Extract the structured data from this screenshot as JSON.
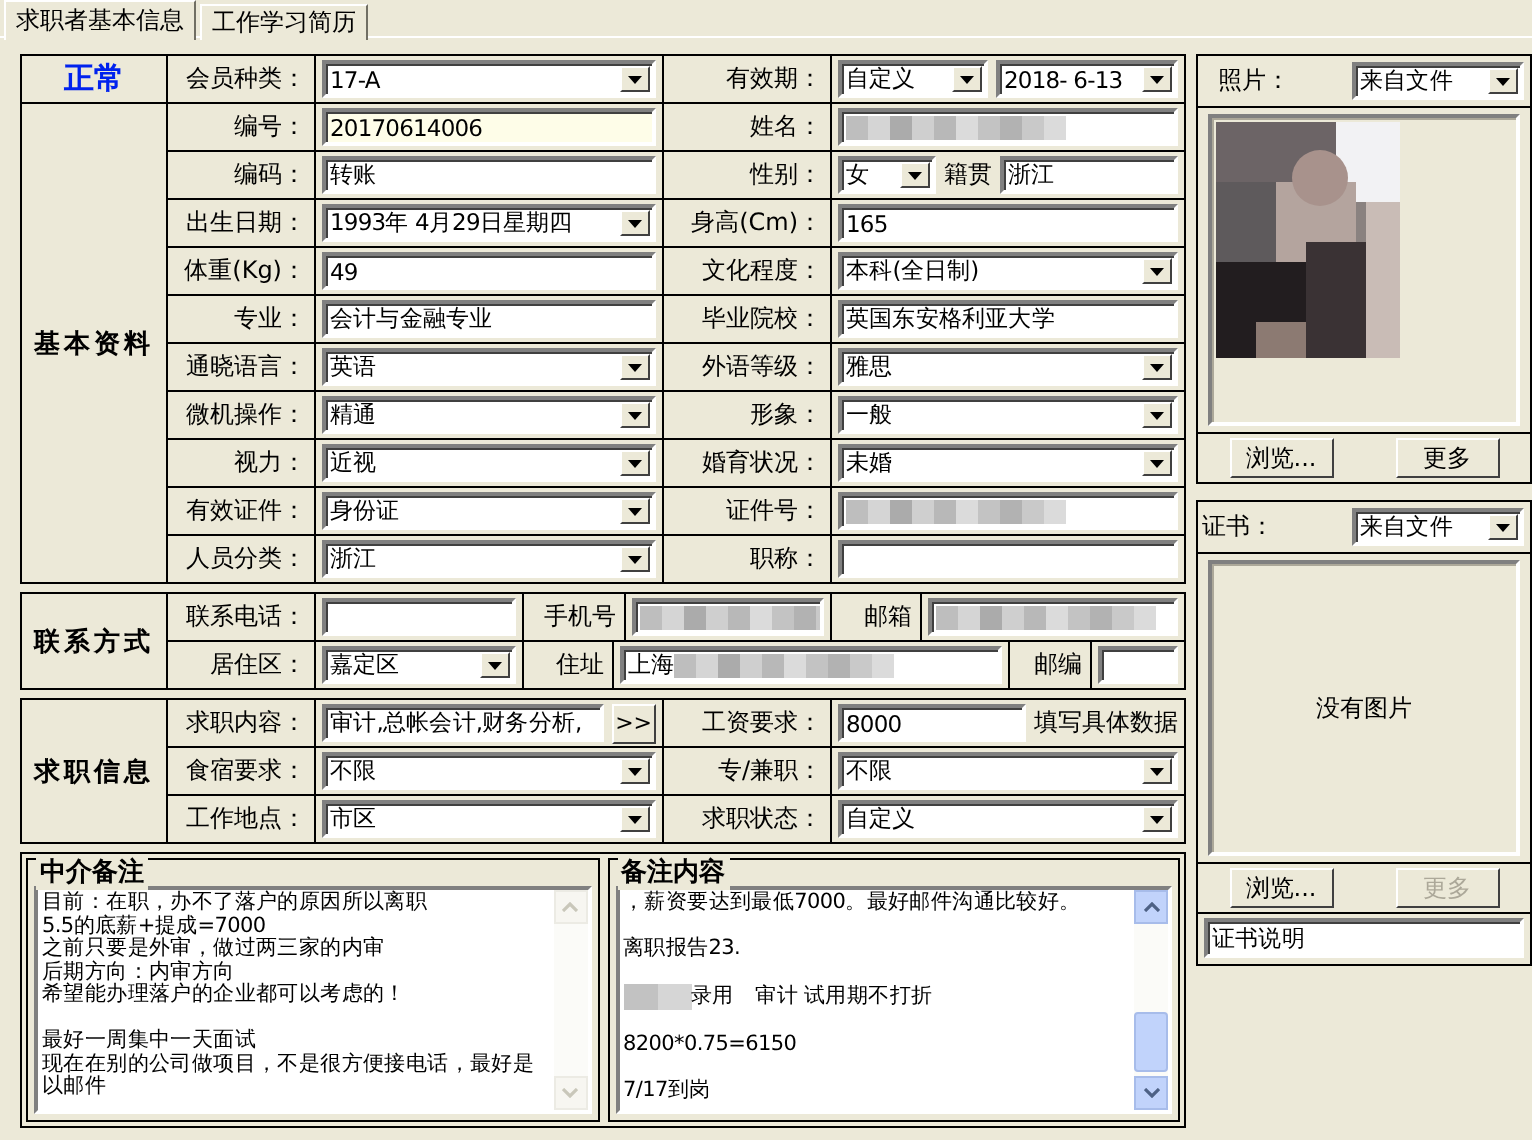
{
  "tabs": [
    {
      "label": "求职者基本信息",
      "selected": true
    },
    {
      "label": "工作学习简历",
      "selected": false
    }
  ],
  "sections": [
    {
      "title": "基本资料",
      "kind": "grid",
      "header": {
        "status": "正常",
        "pairs": [
          {
            "label": "会员种类：",
            "fields": [
              {
                "kind": "select",
                "value": "17-A"
              }
            ]
          },
          {
            "label": "有效期：",
            "fields": [
              {
                "kind": "select",
                "value": "自定义"
              },
              {
                "kind": "select",
                "value": "2018- 6-13"
              }
            ]
          }
        ]
      },
      "rows": [
        [
          {
            "label": "编号：",
            "fields": [
              {
                "kind": "active-text",
                "value": "20170614006"
              }
            ]
          },
          {
            "label": "姓名：",
            "fields": [
              {
                "kind": "redacted"
              }
            ]
          }
        ],
        [
          {
            "label": "编码：",
            "fields": [
              {
                "kind": "text",
                "value": "转账"
              }
            ]
          },
          {
            "label": "性别：",
            "fields": [
              {
                "kind": "select",
                "value": "女"
              },
              {
                "kind": "caption",
                "value": "籍贯"
              },
              {
                "kind": "text",
                "value": "浙江"
              }
            ]
          }
        ],
        [
          {
            "label": "出生日期：",
            "fields": [
              {
                "kind": "select",
                "value": "1993年 4月29日星期四"
              }
            ]
          },
          {
            "label": "身高(Cm)：",
            "fields": [
              {
                "kind": "text",
                "value": "165"
              }
            ]
          }
        ],
        [
          {
            "label": "体重(Kg)：",
            "fields": [
              {
                "kind": "text",
                "value": "49"
              }
            ]
          },
          {
            "label": "文化程度：",
            "fields": [
              {
                "kind": "select",
                "value": "本科(全日制)"
              }
            ]
          }
        ],
        [
          {
            "label": "专业：",
            "fields": [
              {
                "kind": "text",
                "value": "会计与金融专业"
              }
            ]
          },
          {
            "label": "毕业院校：",
            "fields": [
              {
                "kind": "text",
                "value": "英国东安格利亚大学"
              }
            ]
          }
        ],
        [
          {
            "label": "通晓语言：",
            "fields": [
              {
                "kind": "select",
                "value": "英语"
              }
            ]
          },
          {
            "label": "外语等级：",
            "fields": [
              {
                "kind": "select",
                "value": "雅思"
              }
            ]
          }
        ],
        [
          {
            "label": "微机操作：",
            "fields": [
              {
                "kind": "select",
                "value": "精通"
              }
            ]
          },
          {
            "label": "形象：",
            "fields": [
              {
                "kind": "select",
                "value": "一般"
              }
            ]
          }
        ],
        [
          {
            "label": "视力：",
            "fields": [
              {
                "kind": "select",
                "value": "近视"
              }
            ]
          },
          {
            "label": "婚育状况：",
            "fields": [
              {
                "kind": "select",
                "value": "未婚"
              }
            ]
          }
        ],
        [
          {
            "label": "有效证件：",
            "fields": [
              {
                "kind": "select",
                "value": "身份证"
              }
            ]
          },
          {
            "label": "证件号：",
            "fields": [
              {
                "kind": "redacted"
              }
            ]
          }
        ],
        [
          {
            "label": "人员分类：",
            "fields": [
              {
                "kind": "select",
                "value": "浙江"
              }
            ]
          },
          {
            "label": "职称：",
            "fields": [
              {
                "kind": "text"
              }
            ]
          }
        ]
      ]
    },
    {
      "title": "联系方式",
      "kind": "contact",
      "rows": [
        [
          {
            "label": "联系电话：",
            "fields": [
              {
                "kind": "text"
              }
            ]
          },
          {
            "label": "手机号",
            "fields": [
              {
                "kind": "redacted"
              }
            ]
          },
          {
            "label": "邮箱",
            "fields": [
              {
                "kind": "redacted"
              }
            ]
          }
        ],
        [
          {
            "label": "居住区：",
            "fields": [
              {
                "kind": "select",
                "value": "嘉定区"
              }
            ]
          },
          {
            "label": "住址",
            "fields": [
              {
                "kind": "redacted",
                "value": "上海"
              }
            ]
          },
          {
            "label": "邮编",
            "fields": [
              {
                "kind": "text"
              }
            ]
          }
        ]
      ]
    },
    {
      "title": "求职信息",
      "kind": "grid",
      "rows": [
        [
          {
            "label": "求职内容：",
            "fields": [
              {
                "kind": "text",
                "value": "审计,总帐会计,财务分析,"
              },
              {
                "kind": "button",
                "value": ">>"
              }
            ]
          },
          {
            "label": "工资要求：",
            "fields": [
              {
                "kind": "text",
                "value": "8000"
              },
              {
                "kind": "caption",
                "value": "填写具体数据"
              }
            ]
          }
        ],
        [
          {
            "label": "食宿要求：",
            "fields": [
              {
                "kind": "select",
                "value": "不限"
              }
            ]
          },
          {
            "label": "专/兼职：",
            "fields": [
              {
                "kind": "select",
                "value": "不限"
              }
            ]
          }
        ],
        [
          {
            "label": "工作地点：",
            "fields": [
              {
                "kind": "select",
                "value": "市区"
              }
            ]
          },
          {
            "label": "求职状态：",
            "fields": [
              {
                "kind": "select",
                "value": "自定义"
              }
            ]
          }
        ]
      ]
    }
  ],
  "notes": [
    {
      "title": "中介备注",
      "scrollbar_enabled": false,
      "paragraphs": [
        {
          "redacted": false,
          "lines": [
            "目前：在职，办不了落户的原因所以离职",
            "5.5的底薪+提成=7000",
            "之前只要是外审，做过两三家的内审",
            "后期方向：内审方向",
            "希望能办理落户的企业都可以考虑的！"
          ]
        },
        {
          "redacted": false,
          "lines": [
            "最好一周集中一天面试",
            "现在在别的公司做项目，不是很方便接电话，最好是以邮件"
          ]
        }
      ]
    },
    {
      "title": "备注内容",
      "scrollbar_enabled": true,
      "paragraphs": [
        {
          "redacted": false,
          "lines": [
            "，薪资要达到最低7000。最好邮件沟通比较好。"
          ]
        },
        {
          "redacted": false,
          "lines": [
            "离职报告23."
          ]
        },
        {
          "redacted": true,
          "lines": [
            "录用　审计 试用期不打折"
          ]
        },
        {
          "redacted": false,
          "lines": [
            "8200*0.75=6150"
          ]
        },
        {
          "redacted": false,
          "lines": [
            "7/17到岗"
          ]
        }
      ]
    }
  ],
  "photo": {
    "label": "照片：",
    "source": "来自文件",
    "buttons": [
      {
        "label": "浏览...",
        "disabled": false
      },
      {
        "label": "更多",
        "disabled": false
      }
    ]
  },
  "certificate": {
    "label": "证书：",
    "source": "来自文件",
    "empty_text": "没有图片",
    "buttons": [
      {
        "label": "浏览...",
        "disabled": false
      },
      {
        "label": "更多",
        "disabled": true
      }
    ],
    "caption": "证书说明"
  }
}
